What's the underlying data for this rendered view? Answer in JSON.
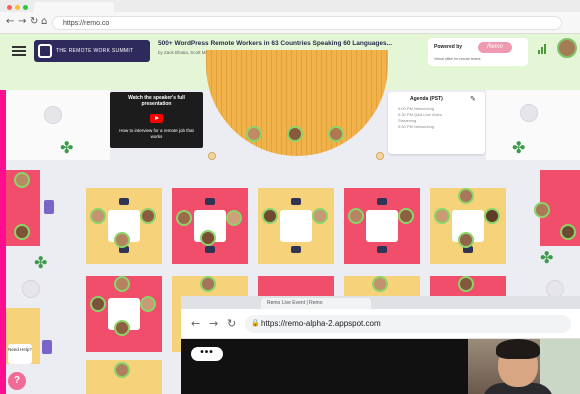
{
  "browser": {
    "url": "https://remo.co",
    "nav_back": "←",
    "nav_forward": "→",
    "nav_reload": "↻",
    "nav_home": "⌂"
  },
  "header": {
    "summit_name": "THE REMOTE WORK SUMMIT",
    "event_title": "500+ WordPress Remote Workers in 63 Countries Speaking 60 Languages...",
    "event_subtitle": "by Zack Bhatia, Scott Millspaugh",
    "powered_by": "Powered by",
    "powered_brand": "Remo",
    "powered_tagline": "Virtual office for remote teams"
  },
  "video_card": {
    "heading": "Watch the speaker's full presentation",
    "body": "How to interview for a remote job that works"
  },
  "agenda": {
    "title": "Agenda (PST)",
    "edit_icon": "edit-icon",
    "items": [
      "9:00 PM Networking",
      "9:30 PM Q&A Live Video",
      "Streaming",
      "9:50 PM Networking"
    ]
  },
  "help": {
    "label": "Need Help?",
    "button": "?"
  },
  "overlay": {
    "tab_label": "Remo Live Event | Remo",
    "url": "https://remo-alpha-2.appspot.com",
    "lock_icon": "lock-icon",
    "more_label": "•••"
  },
  "colors": {
    "header_bg": "#e5f6d6",
    "pink_accent": "#ff0f8f",
    "table_pink": "#f04e6a",
    "table_yellow": "#f6d27a",
    "stage": "#f1b24a",
    "avatar_ring": "#8bd46a",
    "remo_brand": "#ef9ab0"
  },
  "floor": {
    "table_count": 13,
    "stage_attendees": 3
  }
}
